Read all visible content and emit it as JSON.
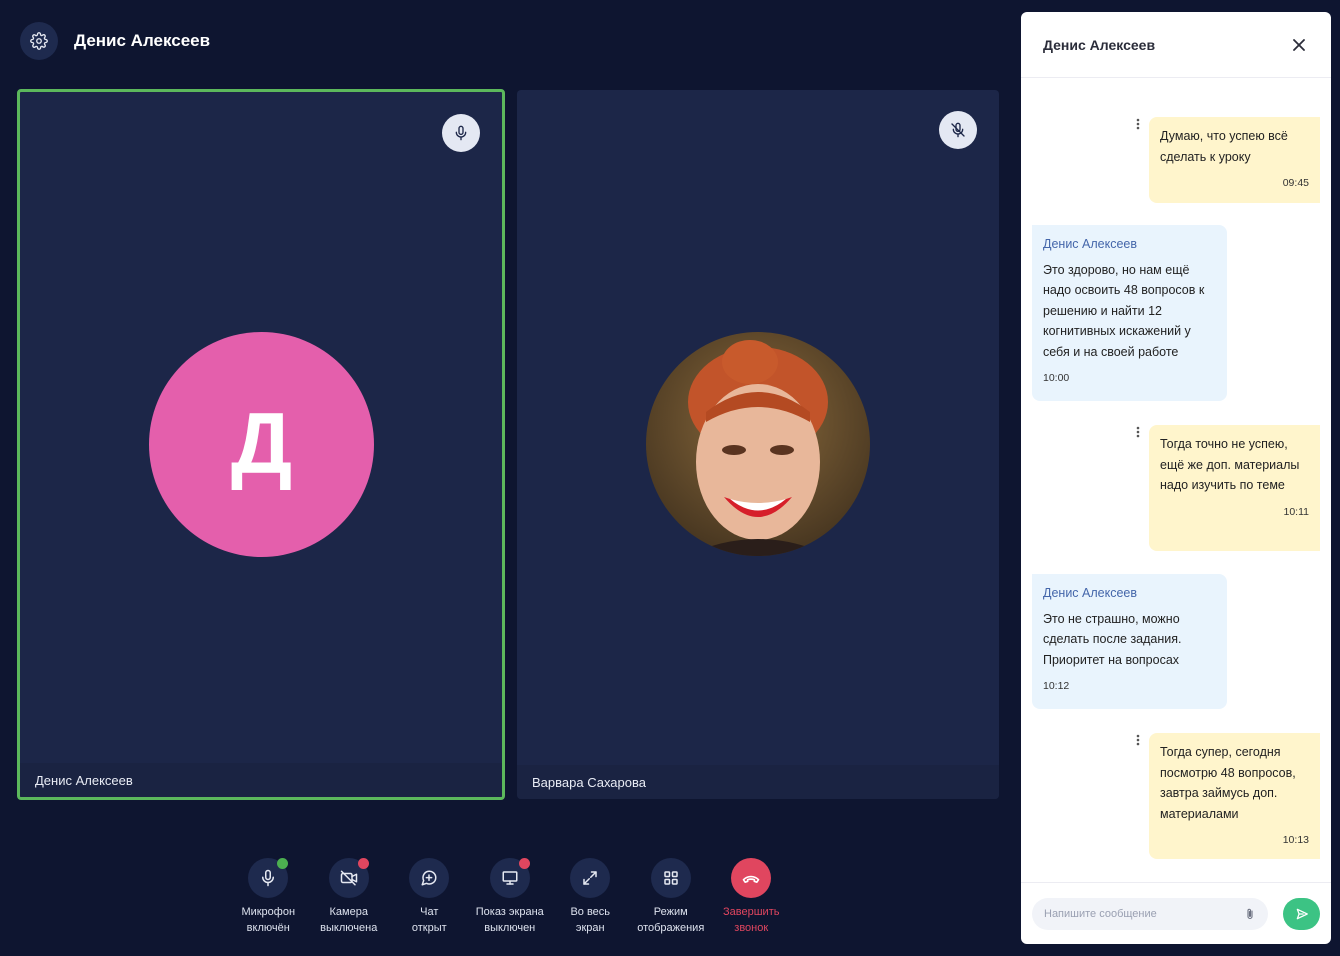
{
  "header": {
    "title": "Денис Алексеев"
  },
  "participants": [
    {
      "name": "Денис Алексеев",
      "initial": "Д",
      "mic": "on",
      "avatar_color": "#e45fac",
      "active": true,
      "active_border": "#5cb85c"
    },
    {
      "name": "Варвара Сахарова",
      "mic": "muted",
      "avatar": "photo"
    }
  ],
  "controls": [
    {
      "label": "Микрофон\nвключён",
      "icon": "mic-icon",
      "status": "on",
      "status_color": "#4caf50"
    },
    {
      "label": "Камера\nвыключена",
      "icon": "camera-off-icon",
      "status": "off",
      "status_color": "#e0465f"
    },
    {
      "label": "Чат\nоткрыт",
      "icon": "chat-plus-icon"
    },
    {
      "label": "Показ экрана\nвыключен",
      "icon": "screen-share-icon",
      "status": "off",
      "status_color": "#e0465f"
    },
    {
      "label": "Во весь\nэкран",
      "icon": "fullscreen-icon"
    },
    {
      "label": "Режим\nотображения",
      "icon": "grid-icon"
    },
    {
      "label": "Завершить\nзвонок",
      "icon": "phone-hangup-icon",
      "color": "#e0465f"
    }
  ],
  "chat": {
    "title": "Денис Алексеев",
    "messages": [
      {
        "direction": "out",
        "text": "Думаю, что успею всё сделать к уроку",
        "time": "09:45"
      },
      {
        "direction": "in",
        "sender": "Денис Алексеев",
        "text": "Это здорово, но нам ещё надо освоить 48 вопросов к решению и найти 12 когнитивных искажений у себя и на своей работе",
        "time": "10:00"
      },
      {
        "direction": "out",
        "text": "Тогда точно не успею, ещё же доп. материалы надо изучить по теме",
        "time": "10:11"
      },
      {
        "direction": "in",
        "sender": "Денис Алексеев",
        "text": "Это не страшно, можно сделать после задания. Приоритет на вопросах",
        "time": "10:12"
      },
      {
        "direction": "out",
        "text": "Тогда супер, сегодня посмотрю 48 вопросов, завтра займусь доп. материалами",
        "time": "10:13"
      }
    ],
    "input_placeholder": "Напишите сообщение",
    "input_value": ""
  },
  "colors": {
    "background": "#0e1530",
    "tile": "#1c2648",
    "accent_green": "#3cc384",
    "danger": "#e0465f",
    "outgoing_bubble": "#fff5cc",
    "incoming_bubble": "#e9f4fd"
  }
}
